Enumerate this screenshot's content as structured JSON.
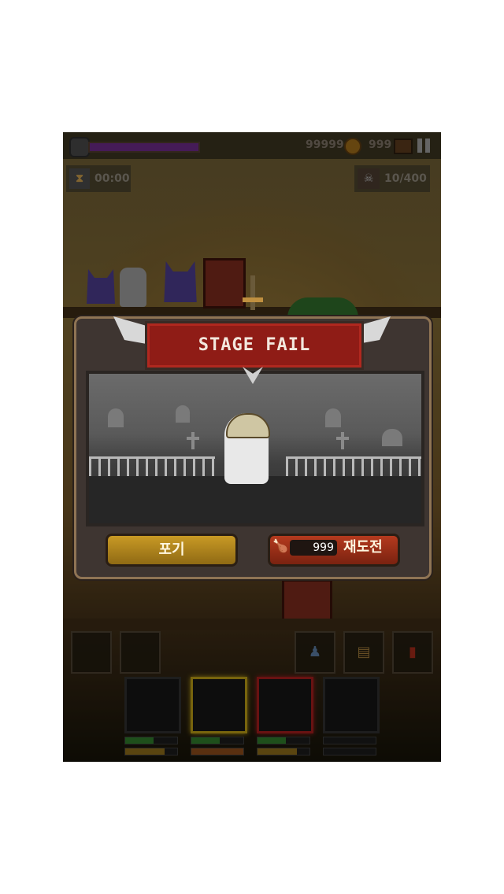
{
  "hud": {
    "coins": "99999",
    "gems": "999",
    "timer": "00:00",
    "kills": "10/400",
    "health_progress": 1.0
  },
  "dialog": {
    "title": "STAGE FAIL",
    "giveup_label": "포기",
    "retry_cost": "999",
    "retry_label": "재도전"
  },
  "icons": {
    "coin": "coin-icon",
    "chest": "chest-icon",
    "pause": "pause-icon",
    "hourglass": "hourglass-icon",
    "skull": "skull-icon",
    "drumstick": "drumstick-icon"
  },
  "colors": {
    "banner": "#8f1c16",
    "giveup_button": "#c99a25",
    "retry_button": "#b53a1e",
    "health_bar": "#6a2a86"
  }
}
